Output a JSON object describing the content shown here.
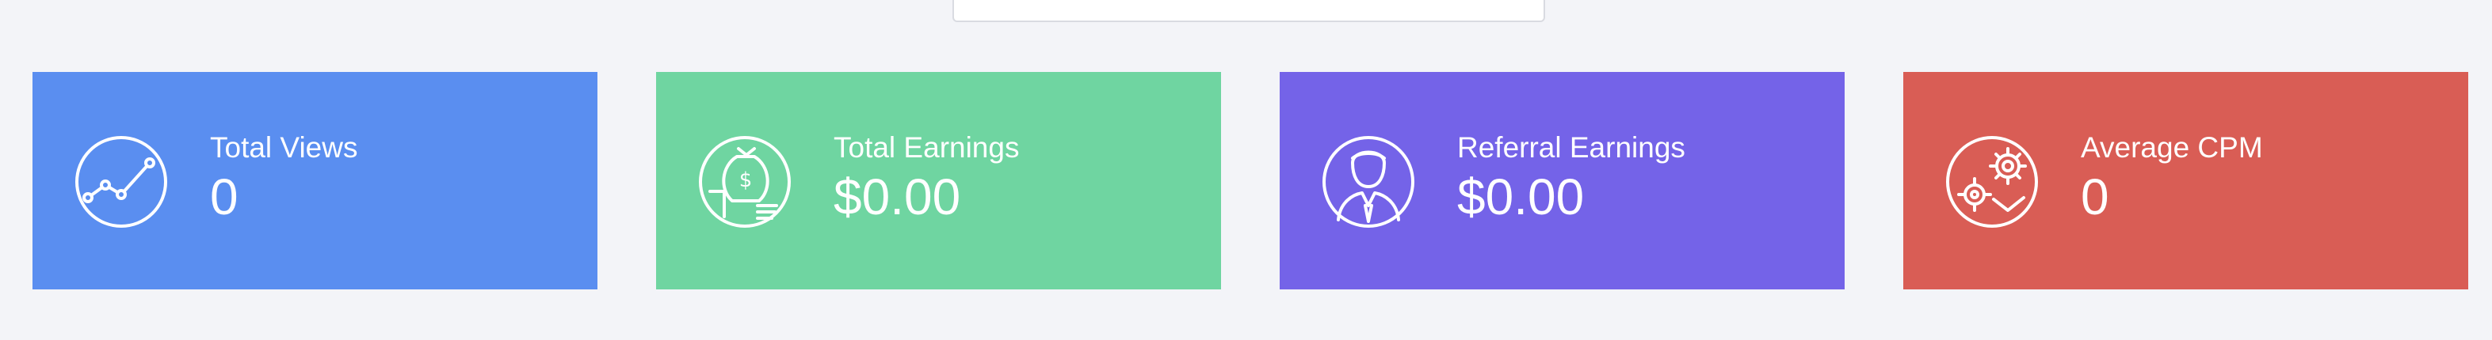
{
  "stats": {
    "cards": [
      {
        "label": "Total Views",
        "value": "0",
        "icon": "line-chart-icon",
        "color": "#5a8ef0"
      },
      {
        "label": "Total Earnings",
        "value": "$0.00",
        "icon": "money-bag-icon",
        "color": "#6fd5a1"
      },
      {
        "label": "Referral Earnings",
        "value": "$0.00",
        "icon": "person-avatar-icon",
        "color": "#7463e8"
      },
      {
        "label": "Average CPM",
        "value": "0",
        "icon": "gears-icon",
        "color": "#d95d55"
      }
    ]
  }
}
